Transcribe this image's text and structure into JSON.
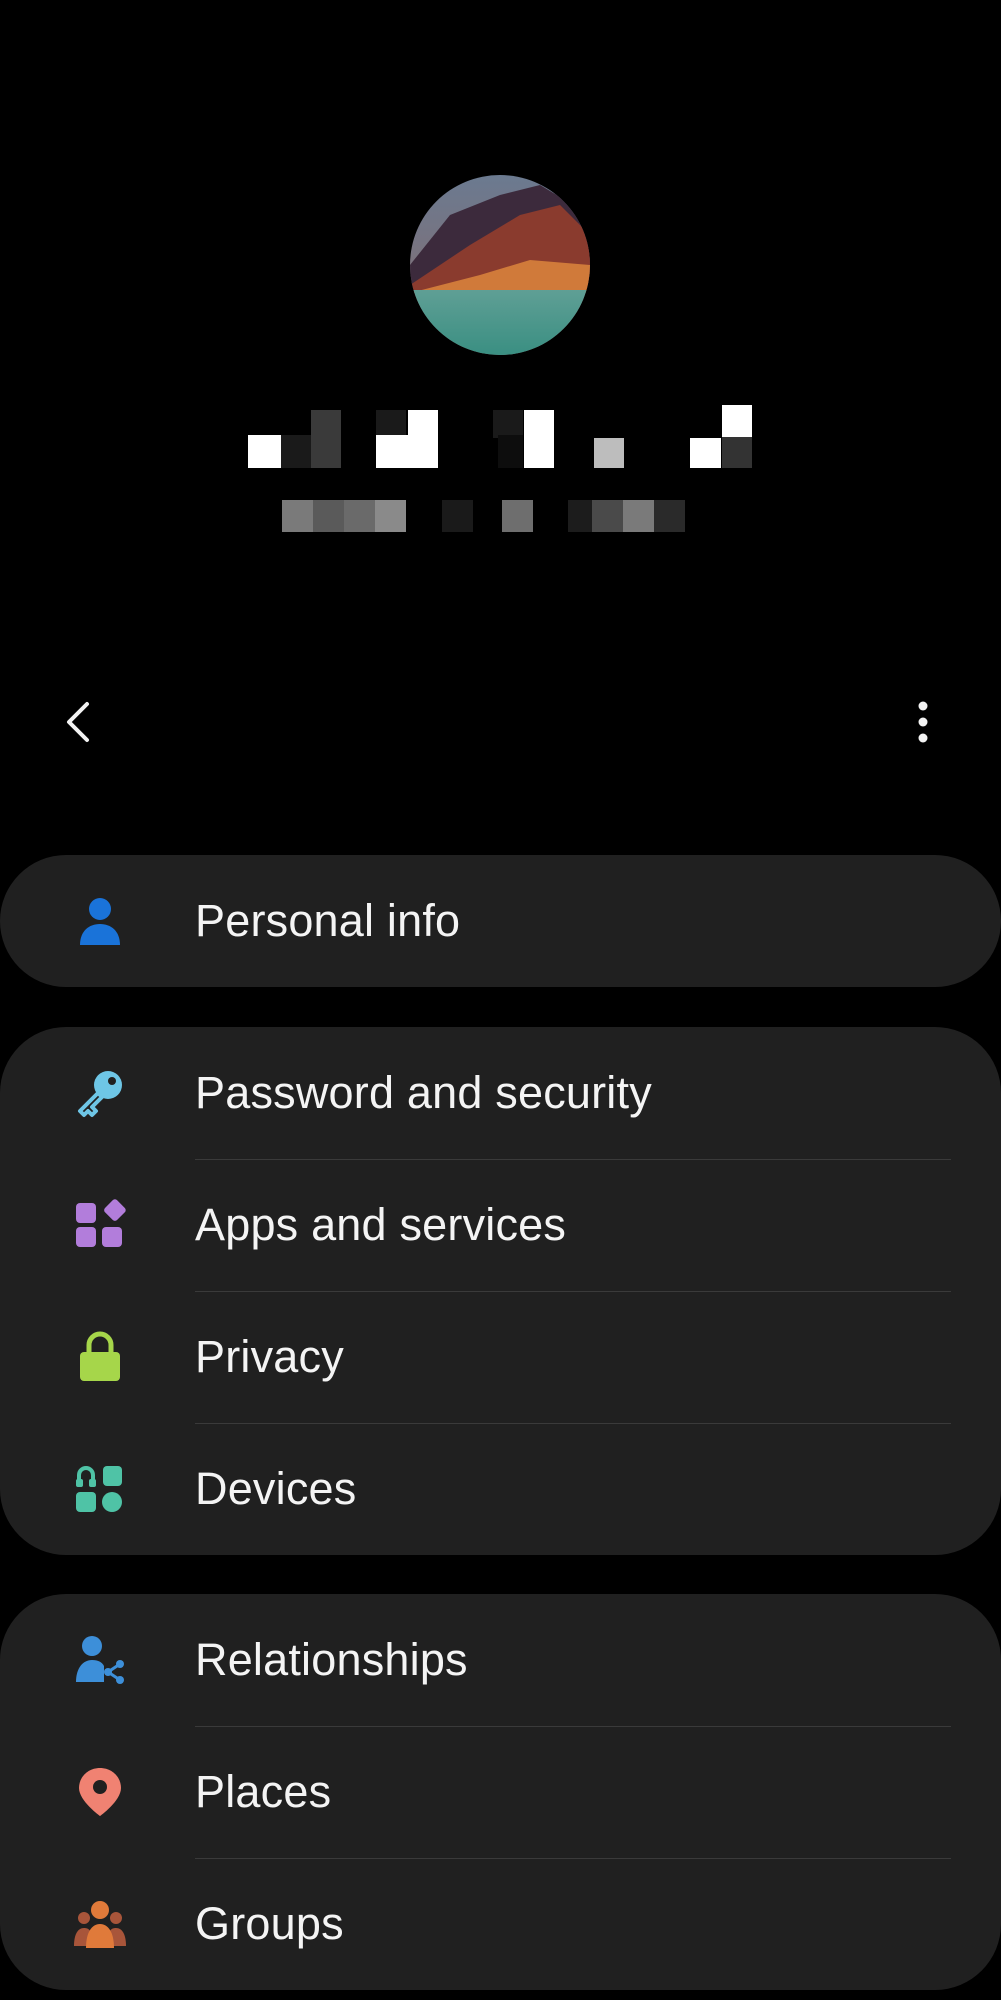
{
  "header": {
    "profile_name": "",
    "profile_email": ""
  },
  "nav": {
    "back_icon": "back-arrow-icon",
    "more_icon": "more-options-icon"
  },
  "sections": [
    {
      "items": [
        {
          "label": "Personal info",
          "icon": "person-icon",
          "color": "#1a73d9"
        }
      ]
    },
    {
      "items": [
        {
          "label": "Password and security",
          "icon": "key-icon",
          "color": "#6ec6e6"
        },
        {
          "label": "Apps and services",
          "icon": "apps-icon",
          "color": "#b27ddb"
        },
        {
          "label": "Privacy",
          "icon": "lock-icon",
          "color": "#a6d64a"
        },
        {
          "label": "Devices",
          "icon": "devices-icon",
          "color": "#4fc3a6"
        }
      ]
    },
    {
      "items": [
        {
          "label": "Relationships",
          "icon": "person-share-icon",
          "color": "#3d8fd9"
        },
        {
          "label": "Places",
          "icon": "location-pin-icon",
          "color": "#f08272"
        },
        {
          "label": "Groups",
          "icon": "group-icon",
          "color": "#e07a3a"
        }
      ]
    }
  ]
}
